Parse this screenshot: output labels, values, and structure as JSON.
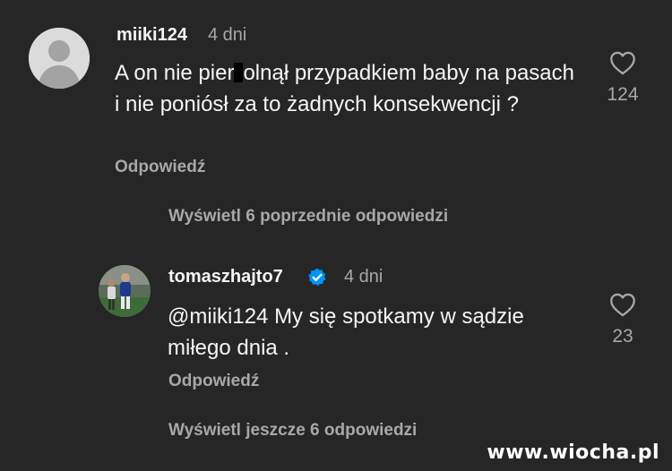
{
  "comment1": {
    "username": "miiki124",
    "time": "4 dni",
    "text_part1": "A on nie pier",
    "text_part2": "olnął przypadkiem baby na pasach i nie poniósł za to żadnych konsekwencji ?",
    "reply_label": "Odpowiedź",
    "likes": "124",
    "avatar_icon": "default-user-avatar"
  },
  "view_previous": "Wyświetl 6 poprzednie odpowiedzi",
  "comment2": {
    "username": "tomaszhajto7",
    "verified_icon": "verified-badge-icon",
    "time": "4 dni",
    "text": "@miiki124 My się spotkamy w sądzie miłego dnia .",
    "reply_label": "Odpowiedź",
    "likes": "23",
    "avatar_icon": "football-player-photo"
  },
  "view_more": "Wyświetl jeszcze 6 odpowiedzi",
  "watermark": "www.wiocha.pl",
  "colors": {
    "background": "#262626",
    "primary_text": "#f5f5f5",
    "secondary_text": "#a8a8a8",
    "verified": "#0095f6"
  }
}
